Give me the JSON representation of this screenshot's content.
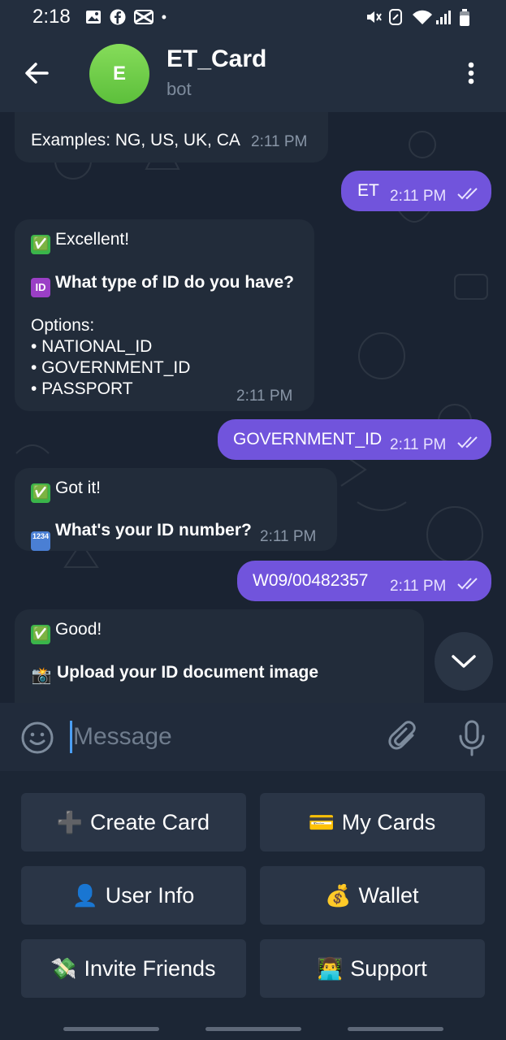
{
  "status_bar": {
    "time": "2:18",
    "dot": "•",
    "left_icons": [
      "gallery-icon",
      "facebook-icon",
      "capcut-icon"
    ],
    "right_icons": [
      "mute-icon",
      "data-saver-icon",
      "wifi-icon",
      "signal-icon",
      "battery-icon"
    ]
  },
  "header": {
    "title": "ET_Card",
    "subtitle": "bot",
    "avatar_letter": "E",
    "avatar_color": "#6ccb46"
  },
  "messages": [
    {
      "side": "in",
      "text": "Examples: NG, US, UK, CA",
      "time": "2:11 PM"
    },
    {
      "side": "out",
      "text": "ET",
      "time": "2:11 PM"
    },
    {
      "side": "in",
      "line1_icon": "✅",
      "line1": "Excellent!",
      "line2_icon": "ID",
      "line2": "What type of ID do you have?",
      "options_title": "Options:",
      "options": [
        "• NATIONAL_ID",
        "• GOVERNMENT_ID",
        "• PASSPORT"
      ],
      "time": "2:11 PM"
    },
    {
      "side": "out",
      "text": "GOVERNMENT_ID",
      "time": "2:11 PM"
    },
    {
      "side": "in",
      "line1_icon": "✅",
      "line1": "Got it!",
      "line2_icon": "1234",
      "line2": "What's your ID number?",
      "time": "2:11 PM"
    },
    {
      "side": "out",
      "text": "W09/00482357",
      "time": "2:11 PM"
    },
    {
      "side": "in",
      "line1_icon": "✅",
      "line1": "Good!",
      "line2_icon": "📸",
      "line2": "Upload your ID document image"
    }
  ],
  "input": {
    "placeholder": "Message"
  },
  "keyboard": [
    {
      "icon": "➕",
      "label": "Create Card"
    },
    {
      "icon": "💳",
      "label": "My Cards"
    },
    {
      "icon": "👤",
      "label": "User Info"
    },
    {
      "icon": "💰",
      "label": "Wallet"
    },
    {
      "icon": "💸",
      "label": "Invite Friends"
    },
    {
      "icon": "👨‍💻",
      "label": "Support"
    }
  ],
  "colors": {
    "outgoing_bubble": "#7154dc",
    "incoming_bubble": "#222c3a",
    "background": "#1a2332",
    "accent": "#4c9ff5"
  }
}
